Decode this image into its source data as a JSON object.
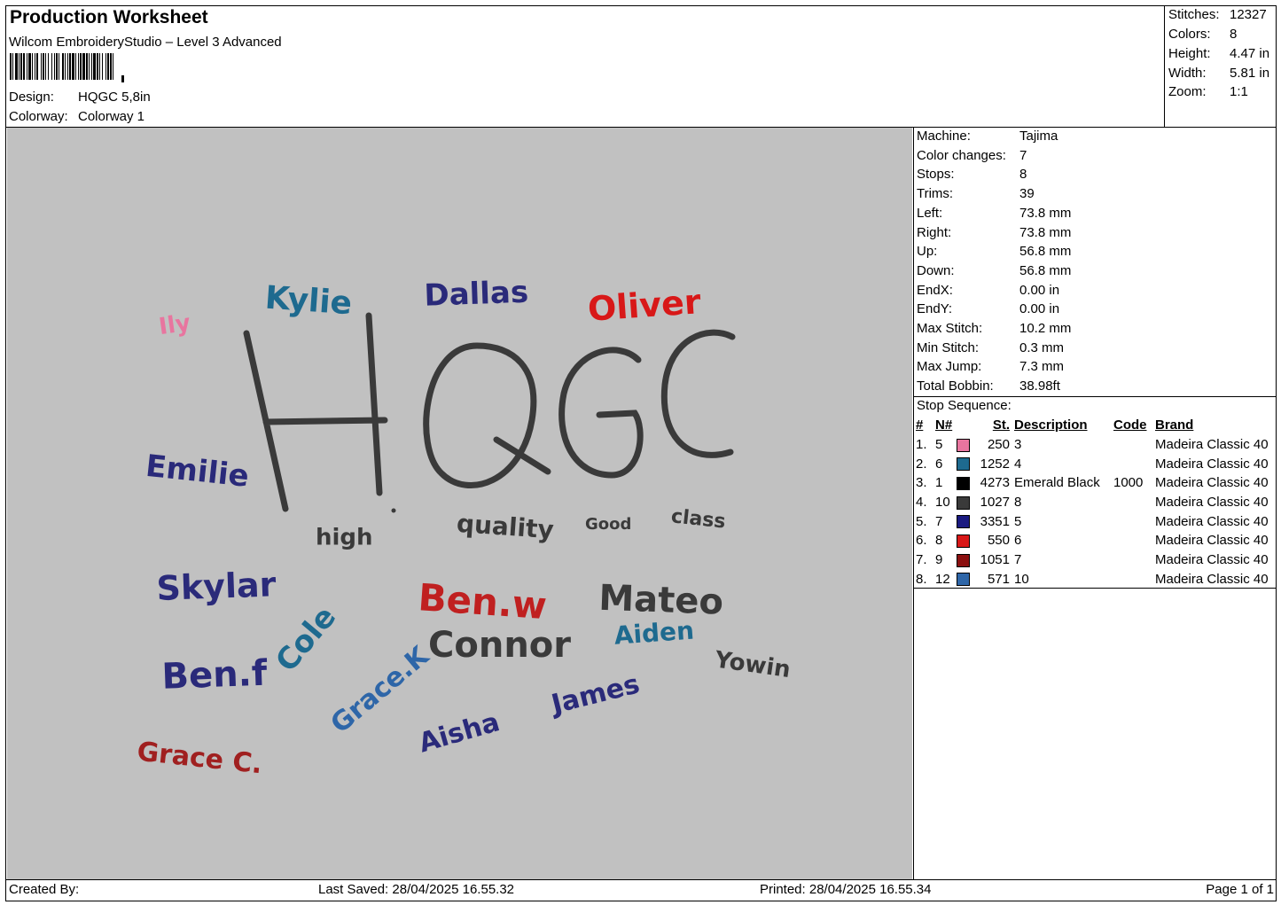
{
  "header": {
    "title": "Production Worksheet",
    "subtitle": "Wilcom EmbroideryStudio – Level 3 Advanced",
    "design_label": "Design:",
    "design_value": "HQGC 5,8in",
    "colorway_label": "Colorway:",
    "colorway_value": "Colorway 1"
  },
  "stats": [
    {
      "label": "Stitches:",
      "value": "12327"
    },
    {
      "label": "Colors:",
      "value": "8"
    },
    {
      "label": "Height:",
      "value": "4.47 in"
    },
    {
      "label": "Width:",
      "value": "5.81 in"
    },
    {
      "label": "Zoom:",
      "value": "1:1"
    }
  ],
  "machine_info": [
    {
      "label": "Machine:",
      "value": "Tajima"
    },
    {
      "label": "Color changes:",
      "value": "7"
    },
    {
      "label": "Stops:",
      "value": "8"
    },
    {
      "label": "Trims:",
      "value": "39"
    },
    {
      "label": "Left:",
      "value": "73.8 mm"
    },
    {
      "label": "Right:",
      "value": "73.8 mm"
    },
    {
      "label": "Up:",
      "value": "56.8 mm"
    },
    {
      "label": "Down:",
      "value": "56.8 mm"
    },
    {
      "label": "EndX:",
      "value": "0.00 in"
    },
    {
      "label": "EndY:",
      "value": "0.00 in"
    },
    {
      "label": "Max Stitch:",
      "value": "10.2 mm"
    },
    {
      "label": "Min Stitch:",
      "value": "0.3 mm"
    },
    {
      "label": "Max Jump:",
      "value": "7.3 mm"
    },
    {
      "label": "Total Bobbin:",
      "value": "38.98ft"
    }
  ],
  "stop_sequence": {
    "title": "Stop Sequence:",
    "headers": [
      "#",
      "N#",
      "St.",
      "Description",
      "Code",
      "Brand"
    ],
    "rows": [
      {
        "idx": "1.",
        "n": "5",
        "color": "#e8759f",
        "st": "250",
        "desc": "3",
        "code": "",
        "brand": "Madeira Classic 40"
      },
      {
        "idx": "2.",
        "n": "6",
        "color": "#1e6a8f",
        "st": "1252",
        "desc": "4",
        "code": "",
        "brand": "Madeira Classic 40"
      },
      {
        "idx": "3.",
        "n": "1",
        "color": "#000000",
        "st": "4273",
        "desc": "Emerald Black",
        "code": "1000",
        "brand": "Madeira Classic 40"
      },
      {
        "idx": "4.",
        "n": "10",
        "color": "#3a3a3a",
        "st": "1027",
        "desc": "8",
        "code": "",
        "brand": "Madeira Classic 40"
      },
      {
        "idx": "5.",
        "n": "7",
        "color": "#1a1a80",
        "st": "3351",
        "desc": "5",
        "code": "",
        "brand": "Madeira Classic 40"
      },
      {
        "idx": "6.",
        "n": "8",
        "color": "#d81818",
        "st": "550",
        "desc": "6",
        "code": "",
        "brand": "Madeira Classic 40"
      },
      {
        "idx": "7.",
        "n": "9",
        "color": "#8b1010",
        "st": "1051",
        "desc": "7",
        "code": "",
        "brand": "Madeira Classic 40"
      },
      {
        "idx": "8.",
        "n": "12",
        "color": "#2e66a8",
        "st": "571",
        "desc": "10",
        "code": "",
        "brand": "Madeira Classic 40"
      }
    ]
  },
  "design_preview": {
    "main": "HQGC",
    "words": [
      {
        "text": "Ily",
        "color": "#e8759f"
      },
      {
        "text": "Kylie",
        "color": "#1e6a8f"
      },
      {
        "text": "Dallas",
        "color": "#2a2a7a"
      },
      {
        "text": "Oliver",
        "color": "#d81818"
      },
      {
        "text": "Emilie",
        "color": "#2a2a7a"
      },
      {
        "text": "high",
        "color": "#3a3a3a"
      },
      {
        "text": "quality",
        "color": "#3a3a3a"
      },
      {
        "text": "Good",
        "color": "#3a3a3a"
      },
      {
        "text": "class",
        "color": "#3a3a3a"
      },
      {
        "text": "Skylar",
        "color": "#2a2a7a"
      },
      {
        "text": "Ben.w",
        "color": "#c02020"
      },
      {
        "text": "Mateo",
        "color": "#3a3a3a"
      },
      {
        "text": "Connor",
        "color": "#3a3a3a"
      },
      {
        "text": "Aiden",
        "color": "#1e6a8f"
      },
      {
        "text": "Ben.f",
        "color": "#2a2a7a"
      },
      {
        "text": "Cole",
        "color": "#1e6a8f"
      },
      {
        "text": "Yowin",
        "color": "#3a3a3a"
      },
      {
        "text": "Grace.K",
        "color": "#2e66a8"
      },
      {
        "text": "James",
        "color": "#2a2a7a"
      },
      {
        "text": "Aisha",
        "color": "#2a2a7a"
      },
      {
        "text": "Grace C.",
        "color": "#a02020"
      }
    ]
  },
  "footer": {
    "created_by": "Created By:",
    "last_saved": "Last Saved: 28/04/2025 16.55.32",
    "printed": "Printed: 28/04/2025 16.55.34",
    "page": "Page 1 of 1"
  }
}
